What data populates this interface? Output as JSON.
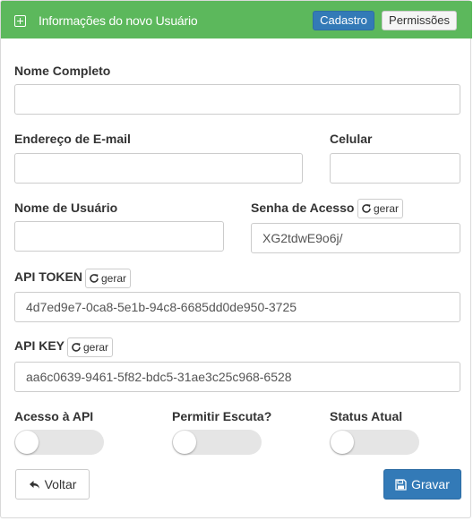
{
  "header": {
    "title": "Informações do novo Usuário",
    "icon": "plus-square-icon",
    "color": "#5cb85c",
    "tabs": [
      {
        "label": "Cadastro",
        "active": true
      },
      {
        "label": "Permissões",
        "active": false
      }
    ]
  },
  "form": {
    "nome_completo": {
      "label": "Nome Completo",
      "value": ""
    },
    "email": {
      "label": "Endereço de E-mail",
      "value": ""
    },
    "celular": {
      "label": "Celular",
      "value": ""
    },
    "usuario": {
      "label": "Nome de Usuário",
      "value": ""
    },
    "senha": {
      "label": "Senha de Acesso",
      "value": "XG2tdwE9o6j/",
      "gerar_label": "gerar"
    },
    "api_token": {
      "label": "API TOKEN",
      "value": "4d7ed9e7-0ca8-5e1b-94c8-6685dd0de950-3725",
      "gerar_label": "gerar"
    },
    "api_key": {
      "label": "API KEY",
      "value": "aa6c0639-9461-5f82-bdc5-31ae3c25c968-6528",
      "gerar_label": "gerar"
    },
    "acesso_api": {
      "label": "Acesso à API",
      "on": false
    },
    "permitir_escuta": {
      "label": "Permitir Escuta?",
      "on": false
    },
    "status_atual": {
      "label": "Status Atual",
      "on": false
    }
  },
  "actions": {
    "voltar_label": "Voltar",
    "gravar_label": "Gravar",
    "primary_color": "#337ab7"
  }
}
